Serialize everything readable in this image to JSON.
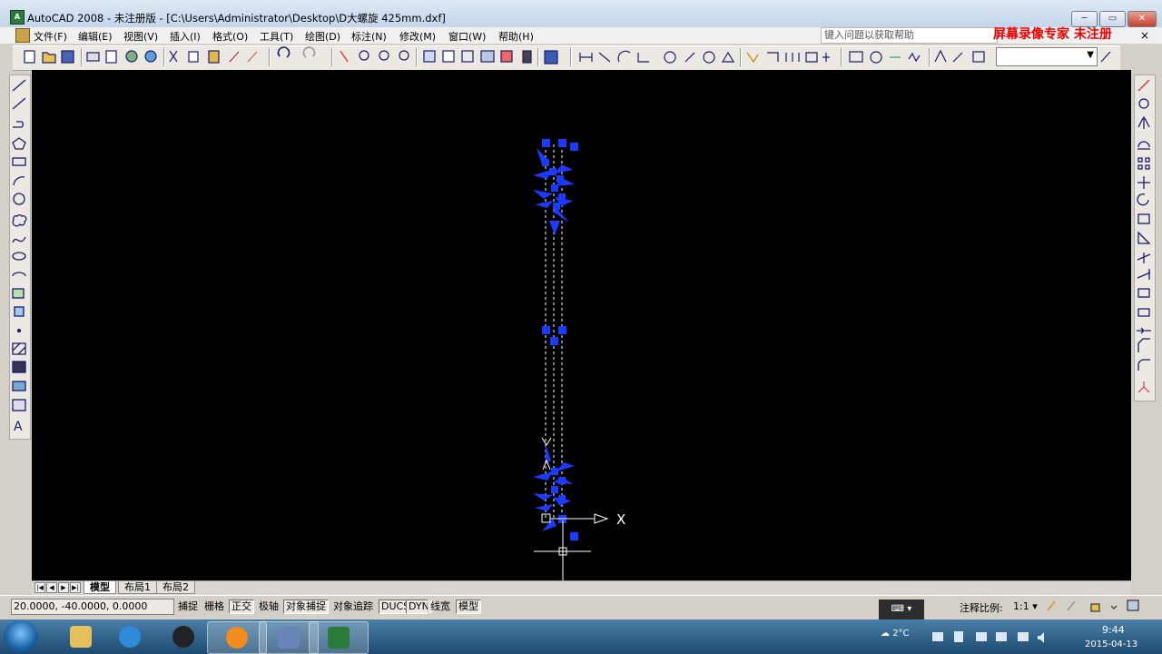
{
  "window": {
    "title": "AutoCAD 2008 - 未注册版 - [C:\\Users\\Administrator\\Desktop\\D大螺旋 425mm.dxf]",
    "app_icon": "autocad-icon",
    "controls": {
      "minimize": "minimize-icon",
      "maximize": "maximize-icon",
      "close": "close-icon"
    }
  },
  "menubar": {
    "items": [
      {
        "label": "文件(F)"
      },
      {
        "label": "编辑(E)"
      },
      {
        "label": "视图(V)"
      },
      {
        "label": "插入(I)"
      },
      {
        "label": "格式(O)"
      },
      {
        "label": "工具(T)"
      },
      {
        "label": "绘图(D)"
      },
      {
        "label": "标注(N)"
      },
      {
        "label": "修改(M)"
      },
      {
        "label": "窗口(W)"
      },
      {
        "label": "帮助(H)"
      }
    ],
    "help_placeholder": "键入问题以获取帮助",
    "watermark": "屏幕录像专家 未注册",
    "close_glyph": "×"
  },
  "toolbar": {
    "combo_value": "",
    "combo_arrow": "▼"
  },
  "canvas": {
    "background": "#000000",
    "selection_color": "#1a3bff",
    "ucs_x_label": "X"
  },
  "layout_tabs": [
    {
      "label": "模型"
    },
    {
      "label": "布局1"
    },
    {
      "label": "布局2"
    }
  ],
  "tab_nav": [
    "|◀",
    "◀",
    "▶",
    "▶|"
  ],
  "statusbar": {
    "coordinates": "20.0000,   -40.0000, 0.0000",
    "toggles": [
      {
        "label": "捕捉",
        "on": false
      },
      {
        "label": "栅格",
        "on": false
      },
      {
        "label": "正交",
        "on": true
      },
      {
        "label": "极轴",
        "on": false
      },
      {
        "label": "对象捕捉",
        "on": true
      },
      {
        "label": "对象追踪",
        "on": false
      },
      {
        "label": "DUCS",
        "on": true
      },
      {
        "label": "DYN",
        "on": true
      },
      {
        "label": "线宽",
        "on": false
      },
      {
        "label": "模型",
        "on": true
      }
    ],
    "annotation_scale_label": "注释比例:",
    "annotation_scale_value": "1:1 ▾"
  },
  "taskbar": {
    "weather": "2°C",
    "time": "9:44",
    "date": "2015-04-13"
  }
}
